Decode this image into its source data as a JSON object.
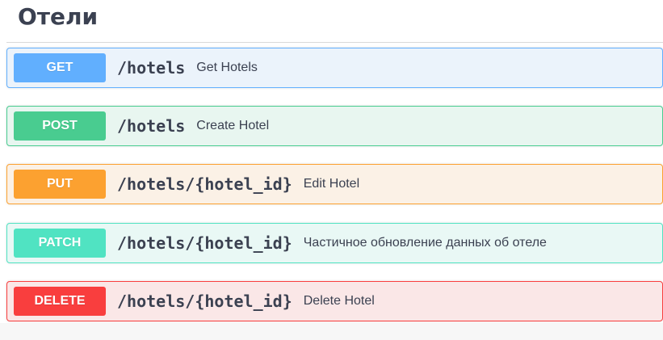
{
  "section": {
    "title": "Отели"
  },
  "operations": [
    {
      "method": "GET",
      "path": "/hotels",
      "summary": "Get Hotels",
      "color": "#61affe"
    },
    {
      "method": "POST",
      "path": "/hotels",
      "summary": "Create Hotel",
      "color": "#49cc90"
    },
    {
      "method": "PUT",
      "path": "/hotels/{hotel_id}",
      "summary": "Edit Hotel",
      "color": "#fca130"
    },
    {
      "method": "PATCH",
      "path": "/hotels/{hotel_id}",
      "summary": "Частичное обновление данных об отеле",
      "color": "#50e3c2"
    },
    {
      "method": "DELETE",
      "path": "/hotels/{hotel_id}",
      "summary": "Delete Hotel",
      "color": "#f93e3e"
    }
  ]
}
